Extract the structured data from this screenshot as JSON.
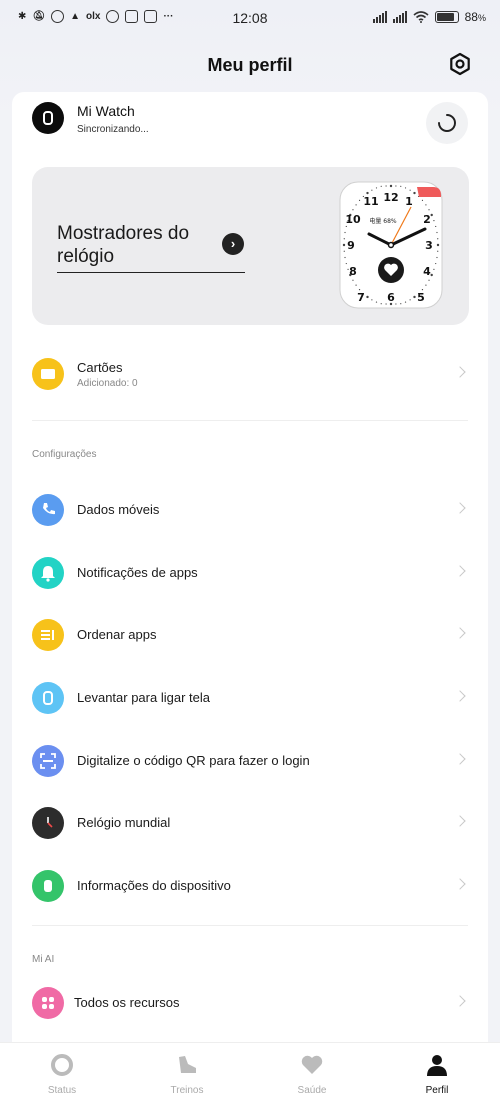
{
  "status_bar": {
    "time": "12:08",
    "left_icons": [
      "bluetooth-icon",
      "muted-icon",
      "alarm-icon",
      "app-icon",
      "olx-icon",
      "vpn-icon",
      "calendar-icon",
      "news-icon",
      "more-icon"
    ],
    "olx_text": "olx",
    "more": "···",
    "battery_percent": "88",
    "battery_suffix": "%",
    "battery_level": 0.88
  },
  "header": {
    "title": "Meu perfil"
  },
  "device": {
    "name": "Mi Watch",
    "status": "Sincronizando..."
  },
  "watchfaces": {
    "title": "Mostradores do relógio",
    "face_numbers": [
      "12",
      "1",
      "2",
      "3",
      "4",
      "5",
      "6",
      "7",
      "8",
      "9",
      "10",
      "11"
    ],
    "face_info": "电量 68%"
  },
  "cards_row": {
    "label": "Cartões",
    "sub": "Adicionado: 0"
  },
  "sections": [
    {
      "label": "Configurações",
      "items": [
        {
          "label": "Dados móveis",
          "icon": "phone-icon",
          "color": "#5a9cf0"
        },
        {
          "label": "Notificações de apps",
          "icon": "bell-icon",
          "color": "#22d3c5"
        },
        {
          "label": "Ordenar apps",
          "icon": "sort-icon",
          "color": "#f7c21a"
        },
        {
          "label": "Levantar para ligar tela",
          "icon": "watch-raise-icon",
          "color": "#5ec4f5"
        },
        {
          "label": "Digitalize o código QR para fazer o login",
          "icon": "qr-scan-icon",
          "color": "#6b8ff0"
        },
        {
          "label": "Relógio mundial",
          "icon": "world-clock-icon",
          "color": "#2c2c2c"
        },
        {
          "label": "Informações do dispositivo",
          "icon": "device-info-icon",
          "color": "#34c46a"
        }
      ]
    },
    {
      "label": "Mi AI",
      "items": [
        {
          "label": "Todos os recursos",
          "icon": "grid-icon",
          "color": "#f06aa5"
        }
      ]
    }
  ],
  "bottom_nav": [
    {
      "label": "Status",
      "icon": "status-ring-icon",
      "active": false
    },
    {
      "label": "Treinos",
      "icon": "shoe-icon",
      "active": false
    },
    {
      "label": "Saúde",
      "icon": "heart-icon",
      "active": false
    },
    {
      "label": "Perfil",
      "icon": "person-icon",
      "active": true
    }
  ],
  "colors": {
    "cards_icon": "#f7c21a",
    "accent": "#111111"
  }
}
